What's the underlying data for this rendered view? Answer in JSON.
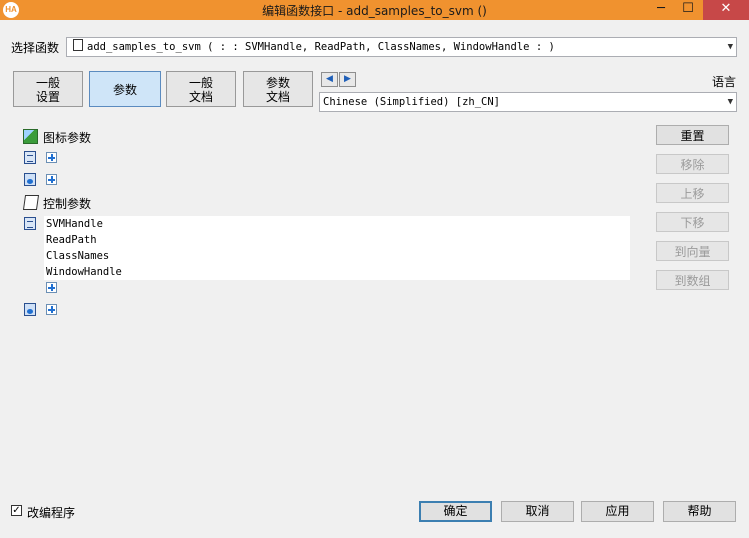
{
  "window": {
    "logo": "HA",
    "title": "编辑函数接口 - add_samples_to_svm ()",
    "min": "─",
    "max": "☐",
    "close": "✕"
  },
  "select_function": {
    "label": "选择函数",
    "value": "add_samples_to_svm ( : : SVMHandle, ReadPath, ClassNames, WindowHandle : )"
  },
  "tabs": [
    {
      "line1": "一般",
      "line2": "设置"
    },
    {
      "label": "参数"
    },
    {
      "line1": "一般",
      "line2": "文档"
    },
    {
      "line1": "参数",
      "line2": "文档"
    }
  ],
  "language": {
    "label": "语言",
    "value": "Chinese (Simplified) [zh_CN]"
  },
  "sections": {
    "icon_params": "图标参数",
    "control_params": "控制参数"
  },
  "control_items": [
    "SVMHandle",
    "ReadPath",
    "ClassNames",
    "WindowHandle"
  ],
  "side_buttons": [
    {
      "label": "重置",
      "enabled": true
    },
    {
      "label": "移除",
      "enabled": false
    },
    {
      "label": "上移",
      "enabled": false
    },
    {
      "label": "下移",
      "enabled": false
    },
    {
      "label": "到向量",
      "enabled": false
    },
    {
      "label": "到数组",
      "enabled": false
    }
  ],
  "footer": {
    "checkbox_label": "改编程序",
    "checked": true,
    "ok": "确定",
    "cancel": "取消",
    "apply": "应用",
    "help": "帮助"
  },
  "colors": {
    "titlebar": "#f0922f",
    "close": "#c74848",
    "accent": "#1f6fd1"
  }
}
